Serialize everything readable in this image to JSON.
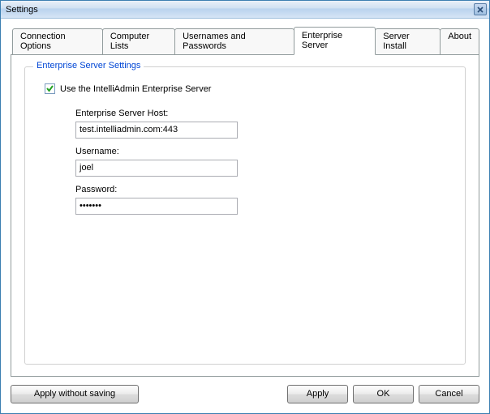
{
  "window": {
    "title": "Settings"
  },
  "tabs": {
    "connection_options": "Connection Options",
    "computer_lists": "Computer Lists",
    "usernames_passwords": "Usernames and Passwords",
    "enterprise_server": "Enterprise Server",
    "server_install": "Server Install",
    "about": "About"
  },
  "groupbox": {
    "title": "Enterprise Server Settings"
  },
  "form": {
    "use_enterprise_label": "Use the IntelliAdmin Enterprise Server",
    "use_enterprise_checked": true,
    "host_label": "Enterprise Server Host:",
    "host_value": "test.intelliadmin.com:443",
    "username_label": "Username:",
    "username_value": "joel",
    "password_label": "Password:",
    "password_value": "•••••••"
  },
  "buttons": {
    "apply_without_saving": "Apply without saving",
    "apply": "Apply",
    "ok": "OK",
    "cancel": "Cancel"
  }
}
